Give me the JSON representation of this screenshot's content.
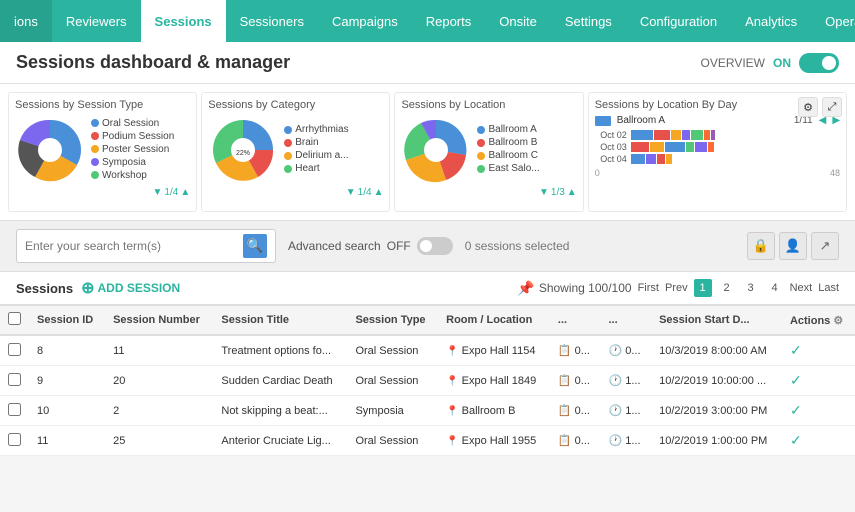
{
  "nav": {
    "items": [
      {
        "label": "ions",
        "active": false
      },
      {
        "label": "Reviewers",
        "active": false
      },
      {
        "label": "Sessions",
        "active": true
      },
      {
        "label": "Sessioners",
        "active": false
      },
      {
        "label": "Campaigns",
        "active": false
      },
      {
        "label": "Reports",
        "active": false
      },
      {
        "label": "Onsite",
        "active": false
      },
      {
        "label": "Settings",
        "active": false
      },
      {
        "label": "Configuration",
        "active": false
      },
      {
        "label": "Analytics",
        "active": false
      },
      {
        "label": "Operation",
        "active": false
      }
    ]
  },
  "header": {
    "title": "Sessions dashboard & manager",
    "overview_label": "OVERVIEW",
    "toggle_state": "ON"
  },
  "charts": {
    "session_type": {
      "title": "Sessions by Session Type",
      "legend": [
        {
          "label": "Oral Session",
          "color": "#4a90d9"
        },
        {
          "label": "Podium Session",
          "color": "#e8514a"
        },
        {
          "label": "Poster Session",
          "color": "#f5a623"
        },
        {
          "label": "Symposia",
          "color": "#7b68ee"
        },
        {
          "label": "Workshop",
          "color": "#50c878"
        }
      ],
      "nav": "1/4"
    },
    "category": {
      "title": "Sessions by Category",
      "legend": [
        {
          "label": "Arrhythmias",
          "color": "#4a90d9"
        },
        {
          "label": "Brain",
          "color": "#e8514a"
        },
        {
          "label": "Delirium a...",
          "color": "#f5a623"
        },
        {
          "label": "Heart",
          "color": "#50c878"
        }
      ],
      "values": [
        "32%",
        "17%",
        "22%"
      ],
      "nav": "1/4"
    },
    "location": {
      "title": "Sessions by Location",
      "legend": [
        {
          "label": "Ballroom A",
          "color": "#4a90d9"
        },
        {
          "label": "Ballroom B",
          "color": "#e8514a"
        },
        {
          "label": "Ballroom C",
          "color": "#f5a623"
        },
        {
          "label": "East Salo...",
          "color": "#50c878"
        }
      ],
      "nav": "1/3"
    },
    "location_by_day": {
      "title": "Sessions by Location By Day",
      "legend_label": "Ballroom A",
      "page_label": "1/11",
      "rows": [
        {
          "label": "Oct 02",
          "bars": [
            "#4a90d9",
            "#e8514a",
            "#f5a623",
            "#7b68ee",
            "#50c878",
            "#ff6b35",
            "#9b59b6"
          ]
        },
        {
          "label": "Oct 03",
          "bars": [
            "#e8514a",
            "#f5a623",
            "#4a90d9",
            "#50c878",
            "#7b68ee",
            "#ff6b35"
          ]
        },
        {
          "label": "Oct 04",
          "bars": [
            "#4a90d9",
            "#7b68ee",
            "#e8514a",
            "#f5a623"
          ]
        }
      ],
      "x_max": "48"
    }
  },
  "search": {
    "placeholder": "Enter your search term(s)",
    "advanced_label": "Advanced search",
    "toggle_label": "OFF",
    "selected_label": "0 sessions selected"
  },
  "sessions_bar": {
    "label": "Sessions",
    "add_label": "ADD SESSION",
    "showing": "Showing 100/100",
    "pagination": {
      "first": "First",
      "prev": "Prev",
      "pages": [
        "1",
        "2",
        "3",
        "4"
      ],
      "next": "Next",
      "last": "Last",
      "active": "1"
    }
  },
  "table": {
    "columns": [
      {
        "label": "",
        "key": "check"
      },
      {
        "label": "Session ID",
        "key": "id"
      },
      {
        "label": "Session Number",
        "key": "number"
      },
      {
        "label": "Session Title",
        "key": "title"
      },
      {
        "label": "Session Type",
        "key": "type"
      },
      {
        "label": "Room / Location",
        "key": "location"
      },
      {
        "label": "...",
        "key": "col6"
      },
      {
        "label": "...",
        "key": "col7"
      },
      {
        "label": "Session Start D...",
        "key": "start_date"
      },
      {
        "label": "Actions",
        "key": "actions"
      }
    ],
    "rows": [
      {
        "id": "8",
        "number": "11",
        "title": "Treatment options fo...",
        "type": "Oral Session",
        "location": "Expo Hall 1154",
        "col6": "0...",
        "col7": "0...",
        "start_date": "10/3/2019 8:00:00 AM",
        "has_check": false
      },
      {
        "id": "9",
        "number": "20",
        "title": "Sudden Cardiac Death",
        "type": "Oral Session",
        "location": "Expo Hall 1849",
        "col6": "0...",
        "col7": "1...",
        "start_date": "10/2/2019 10:00:00 ...",
        "has_check": false
      },
      {
        "id": "10",
        "number": "2",
        "title": "Not skipping a beat:...",
        "type": "Symposia",
        "location": "Ballroom B",
        "col6": "0...",
        "col7": "1...",
        "start_date": "10/2/2019 3:00:00 PM",
        "has_check": false
      },
      {
        "id": "11",
        "number": "25",
        "title": "Anterior Cruciate Lig...",
        "type": "Oral Session",
        "location": "Expo Hall 1955",
        "col6": "0...",
        "col7": "1...",
        "start_date": "10/2/2019 1:00:00 PM",
        "has_check": false
      }
    ]
  }
}
